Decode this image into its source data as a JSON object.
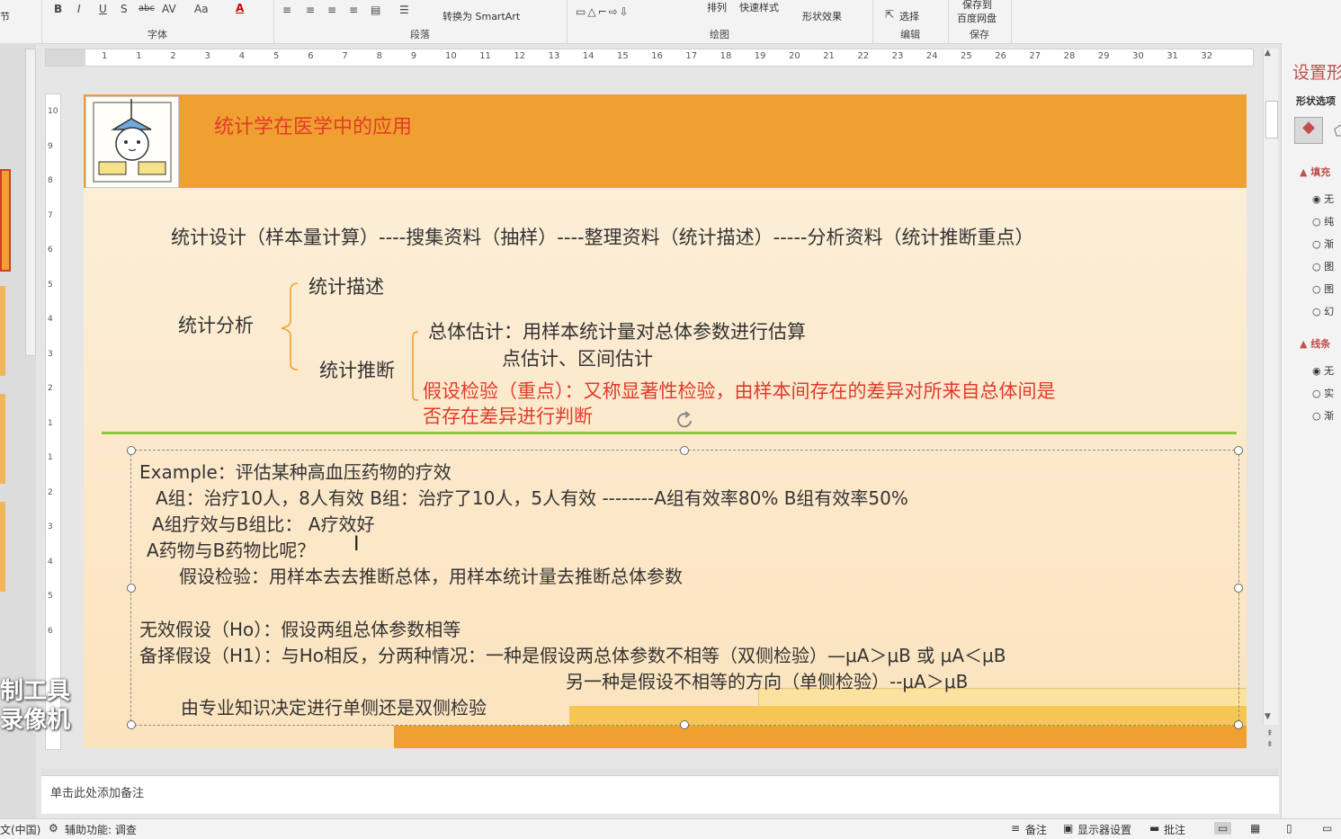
{
  "ribbon": {
    "font_section_label": "字体",
    "paragraph_section_label": "段落",
    "drawing_section_label": "绘图",
    "edit_section_label": "编辑",
    "save_section_label": "保存",
    "truncated_left": "节",
    "convert_smartart": "转换为 SmartArt",
    "arrange": "排列",
    "quick_styles": "快速样式",
    "shape_effects": "形状效果",
    "select": "选择",
    "save_baidu_line1": "保存到",
    "save_baidu_line2": "百度网盘",
    "font_color_letter": "A",
    "bold": "B",
    "italic": "I",
    "underline": "U",
    "shadow": "S",
    "strike": "abc",
    "spacing": "AV",
    "case": "Aa"
  },
  "ruler_h": [
    "1",
    "1",
    "2",
    "3",
    "4",
    "5",
    "6",
    "7",
    "8",
    "9",
    "10",
    "11",
    "12",
    "13",
    "14",
    "15",
    "16",
    "17",
    "18",
    "19",
    "20",
    "21",
    "22",
    "23",
    "24",
    "25",
    "26",
    "27",
    "28",
    "29",
    "30",
    "31",
    "32"
  ],
  "ruler_v": [
    "10",
    "9",
    "8",
    "7",
    "6",
    "5",
    "4",
    "3",
    "2",
    "1",
    "1",
    "2",
    "3",
    "4",
    "5",
    "6"
  ],
  "slide": {
    "title": "统计学在医学中的应用",
    "flow": "统计设计（样本量计算）----搜集资料（抽样）----整理资料（统计描述）-----分析资料（统计推断重点）",
    "analysis": "统计分析",
    "describe": "统计描述",
    "infer": "统计推断",
    "estimate": "总体估计：用样本统计量对总体参数进行估算",
    "estimate_sub": "点估计、区间估计",
    "hypo_line1": "假设检验（重点）：又称显著性检验，由样本间存在的差异对所来自总体间是",
    "hypo_line2": "否存在差异进行判断",
    "ex_1": "Example：评估某种高血压药物的疗效",
    "ex_2": "A组：治疗10人，8人有效    B组：治疗了10人，5人有效 --------A组有效率80%  B组有效率50%",
    "ex_3": "A组疗效与B组比：  A疗效好",
    "ex_4": "A药物与B药物比呢？",
    "ex_5": "假设检验：用样本去去推断总体，用样本统计量去推断总体参数",
    "ex_6": "无效假设（Ho）：假设两组总体参数相等",
    "ex_7": "备择假设（H1）：与Ho相反，分两种情况：一种是假设两总体参数不相等（双侧检验）—μA＞μB  或  μA＜μB",
    "ex_8": "另一种是假设不相等的方向（单侧检验）--μA＞μB",
    "ex_9": "由专业知识决定进行单侧还是双侧检验"
  },
  "pane": {
    "title": "设置形",
    "subtitle": "形状选项",
    "fill_header": "填充",
    "fill_options": [
      "无",
      "纯",
      "渐",
      "图",
      "图",
      "幻"
    ],
    "line_header": "线条",
    "line_options": [
      "无",
      "实",
      "渐"
    ]
  },
  "notes_placeholder": "单击此处添加备注",
  "status": {
    "lang": "文(中国)",
    "accessibility": "辅助功能: 调查",
    "notes": "备注",
    "display": "显示器设置",
    "comments": "批注"
  },
  "watermark": {
    "line1": "制工具",
    "line2": "录像机"
  },
  "colors": {
    "banner": "#f0a030",
    "title_red": "#e03c2c",
    "separator": "#8dc63f",
    "slide_bg_top": "#fdf0dc"
  }
}
